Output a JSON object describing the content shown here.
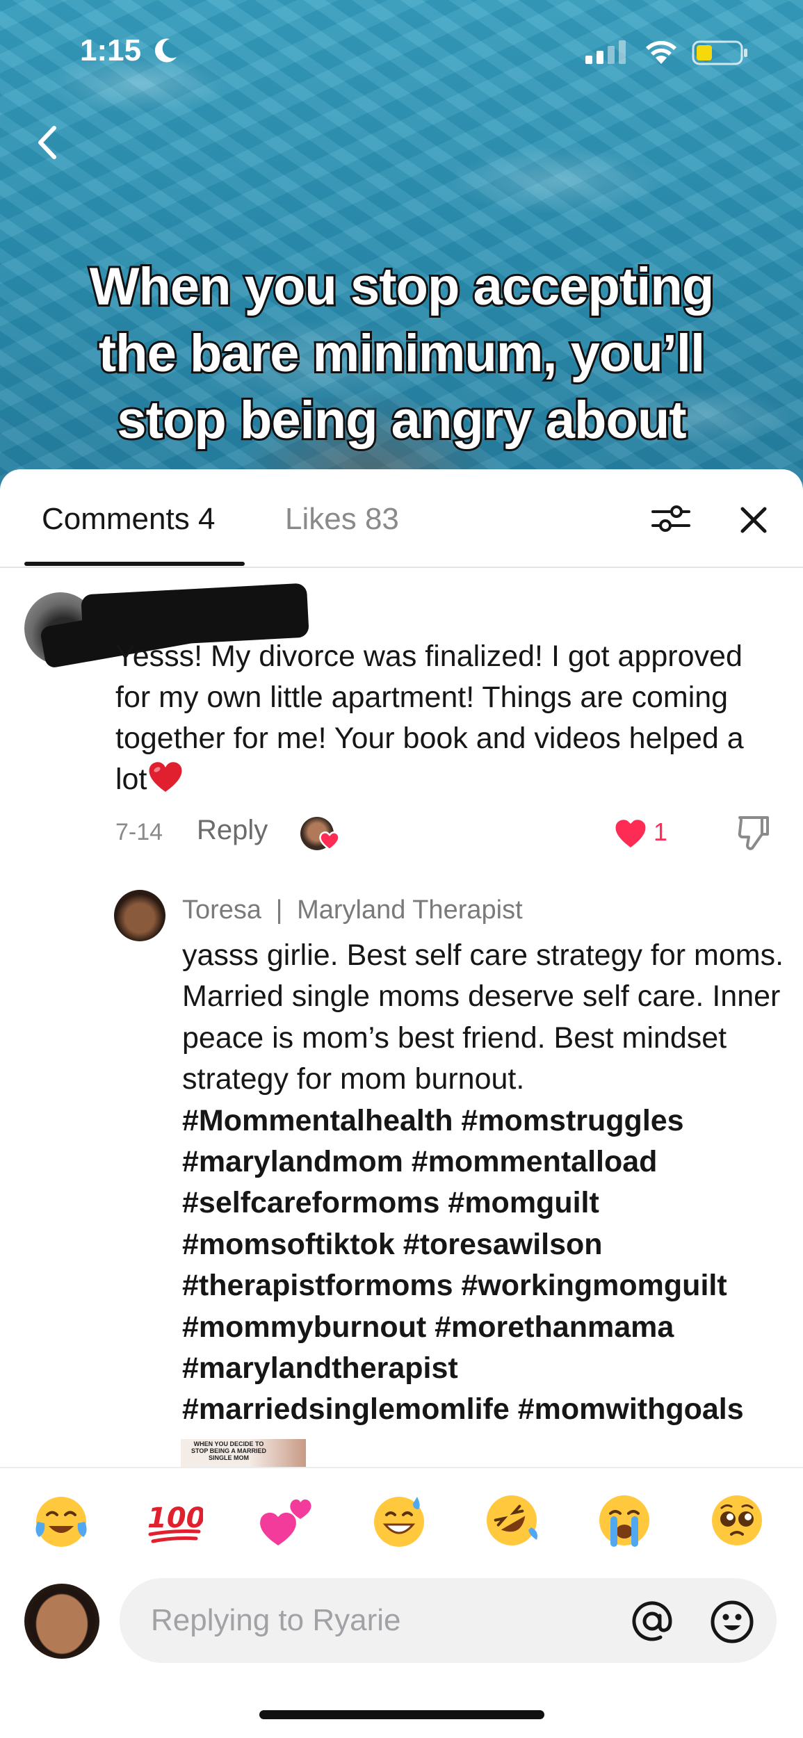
{
  "status_bar": {
    "time": "1:15"
  },
  "video": {
    "caption": "When you stop accepting\nthe bare minimum, you’ll\nstop being angry about"
  },
  "tabs": {
    "comments": "Comments 4",
    "likes": "Likes 83"
  },
  "comment": {
    "text": "Yesss! My divorce was finalized! I got approved for my own little apartment! Things are coming together for me! Your book and videos helped a lot",
    "date": "7-14",
    "reply_label": "Reply",
    "like_count": "1",
    "accent_color": "#fe2c55"
  },
  "reply": {
    "author": "Toresa",
    "separator": "|",
    "author_title": "Maryland Therapist",
    "text": "yasss girlie.  Best self care strategy for moms. Married single moms deserve self care. Inner peace is mom’s best friend. Best mindset strategy for mom burnout.",
    "hashtags": "#Mommentalhealth #momstruggles #marylandmom #mommentalload #selfcareformoms #momguilt #momsoftiktok #toresawilson #therapistformoms #workingmomguilt #mommyburnout #morethanmama #marylandtherapist #marriedsinglemomlife #momwithgoals",
    "thumbnail_text": "WHEN YOU DECIDE TO STOP BEING A MARRIED SINGLE MOM"
  },
  "quick_emojis": [
    "face-with-tears-of-joy",
    "hundred-points",
    "two-hearts",
    "grinning-face-with-sweat",
    "rolling-on-floor-laughing",
    "loudly-crying-face",
    "pleading-face"
  ],
  "compose": {
    "placeholder": "Replying to Ryarie"
  }
}
